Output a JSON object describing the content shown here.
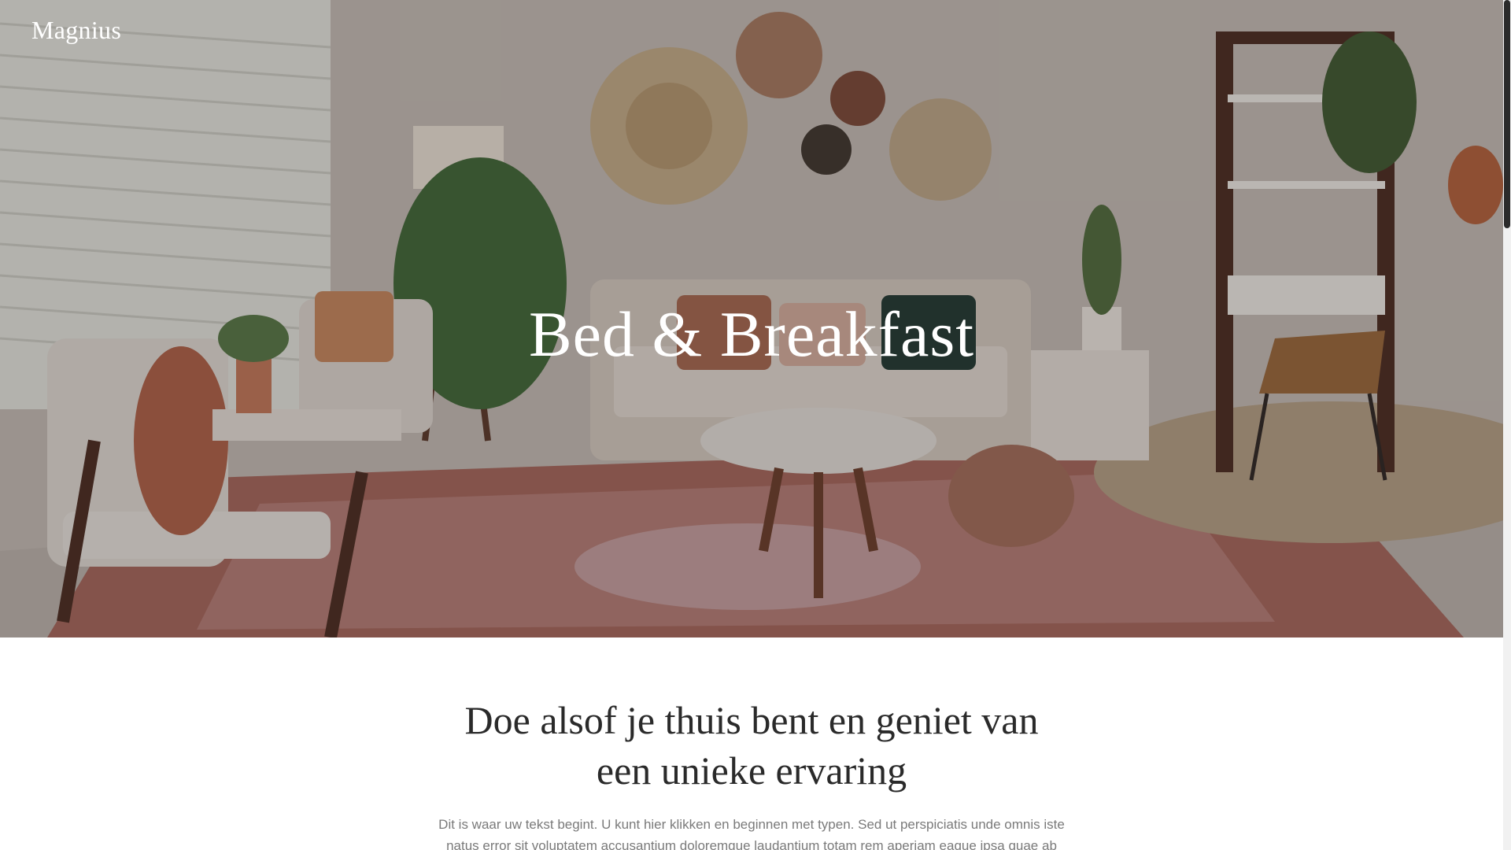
{
  "header": {
    "brand": "Magnius"
  },
  "hero": {
    "title": "Bed & Breakfast",
    "image_description_icon": "living-room-photo"
  },
  "intro": {
    "heading": "Doe alsof je thuis bent en geniet van een unieke ervaring",
    "body": "Dit is waar uw tekst begint. U kunt hier klikken en beginnen met typen. Sed ut perspiciatis unde omnis iste natus error sit voluptatem accusantium doloremque laudantium totam rem aperiam eaque ipsa quae ab"
  },
  "colors": {
    "hero_overlay": "#281e19",
    "heading_text": "#2a2a2a",
    "body_text": "#7a7a7a",
    "hero_text": "#ffffff"
  }
}
